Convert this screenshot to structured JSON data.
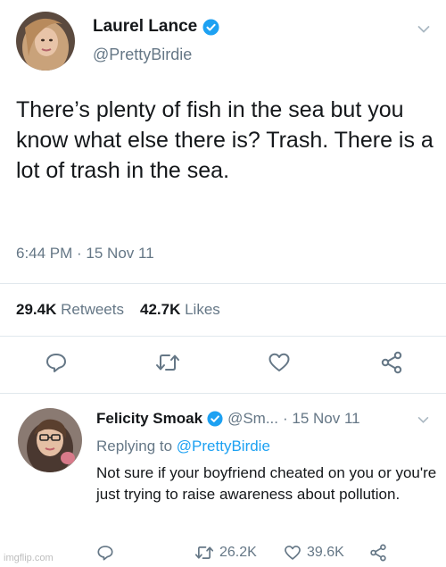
{
  "main_tweet": {
    "display_name": "Laurel Lance",
    "handle": "@PrettyBirdie",
    "text": "There’s plenty of fish in the sea but you know what else there is? Trash. There is a lot of trash in the sea.",
    "timestamp": "6:44 PM · 15 Nov 11",
    "retweets_count": "29.4K",
    "retweets_label": "Retweets",
    "likes_count": "42.7K",
    "likes_label": "Likes",
    "actions": [
      "reply-icon",
      "retweet-icon",
      "like-icon",
      "share-icon"
    ]
  },
  "reply_tweet": {
    "display_name": "Felicity Smoak",
    "handle": "@Sm...",
    "date": "· 15 Nov 11",
    "replying_prefix": "Replying to",
    "replying_to": "@PrettyBirdie",
    "text": "Not sure if your boyfriend cheated on you or you're just trying to raise awareness about pollution.",
    "retweets_count": "26.2K",
    "likes_count": "39.6K"
  },
  "watermark": "imgflip.com",
  "colors": {
    "verified": "#1da1f2",
    "text_primary": "#14171a",
    "text_secondary": "#657786",
    "divider": "#e1e8ed"
  }
}
